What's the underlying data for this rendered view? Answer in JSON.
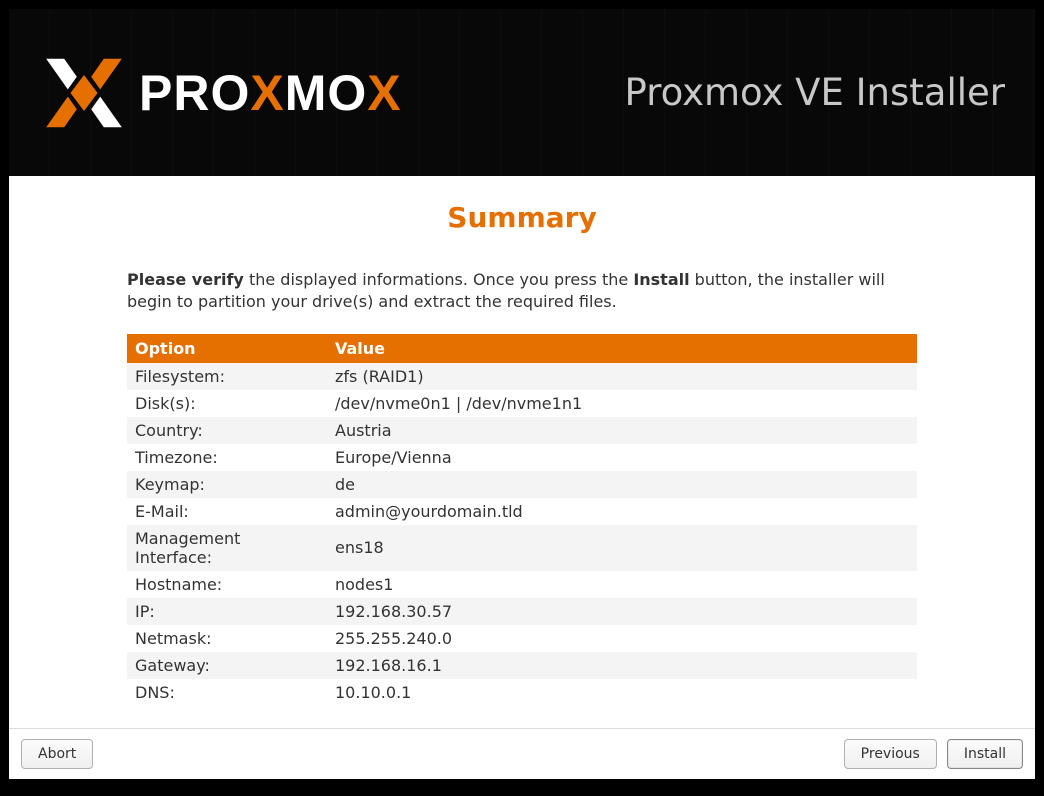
{
  "header": {
    "brand_prefix": "PRO",
    "brand_accent1": "X",
    "brand_mid": "MO",
    "brand_accent2": "X",
    "title": "Proxmox VE Installer"
  },
  "page": {
    "title": "Summary",
    "instruction_bold1": "Please verify",
    "instruction_mid": " the displayed informations. Once you press the ",
    "instruction_bold2": "Install",
    "instruction_end": " button, the installer will begin to partition your drive(s) and extract the required files."
  },
  "table": {
    "headers": {
      "option": "Option",
      "value": "Value"
    },
    "rows": [
      {
        "option": "Filesystem:",
        "value": "zfs (RAID1)"
      },
      {
        "option": "Disk(s):",
        "value": "/dev/nvme0n1 | /dev/nvme1n1"
      },
      {
        "option": "Country:",
        "value": "Austria"
      },
      {
        "option": "Timezone:",
        "value": "Europe/Vienna"
      },
      {
        "option": "Keymap:",
        "value": "de"
      },
      {
        "option": "E-Mail:",
        "value": "admin@yourdomain.tld"
      },
      {
        "option": "Management Interface:",
        "value": "ens18"
      },
      {
        "option": "Hostname:",
        "value": "nodes1"
      },
      {
        "option": "IP:",
        "value": "192.168.30.57"
      },
      {
        "option": "Netmask:",
        "value": "255.255.240.0"
      },
      {
        "option": "Gateway:",
        "value": "192.168.16.1"
      },
      {
        "option": "DNS:",
        "value": "10.10.0.1"
      }
    ]
  },
  "footer": {
    "abort": "Abort",
    "previous": "Previous",
    "install": "Install"
  }
}
